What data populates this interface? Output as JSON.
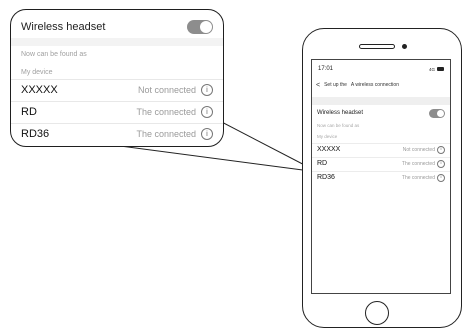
{
  "callout": {
    "title": "Wireless headset",
    "found_as": "Now can be found as",
    "my_device": "My device",
    "devices": [
      {
        "name": "XXXXX",
        "status": "Not connected"
      },
      {
        "name": "RD",
        "status": "The connected"
      },
      {
        "name": "RD36",
        "status": "The connected"
      }
    ],
    "info_glyph": "i",
    "toggle_on": true
  },
  "phone": {
    "time": "17:01",
    "status_icons": "4G",
    "nav_back": "<",
    "nav_back_label": "Set up the",
    "nav_title": "A wireless connection",
    "title": "Wireless headset",
    "found_as": "Now can be found as",
    "my_device": "My device",
    "devices": [
      {
        "name": "XXXXX",
        "status": "Not connected"
      },
      {
        "name": "RD",
        "status": "The connected"
      },
      {
        "name": "RD36",
        "status": "The connected"
      }
    ],
    "info_glyph": "i"
  }
}
